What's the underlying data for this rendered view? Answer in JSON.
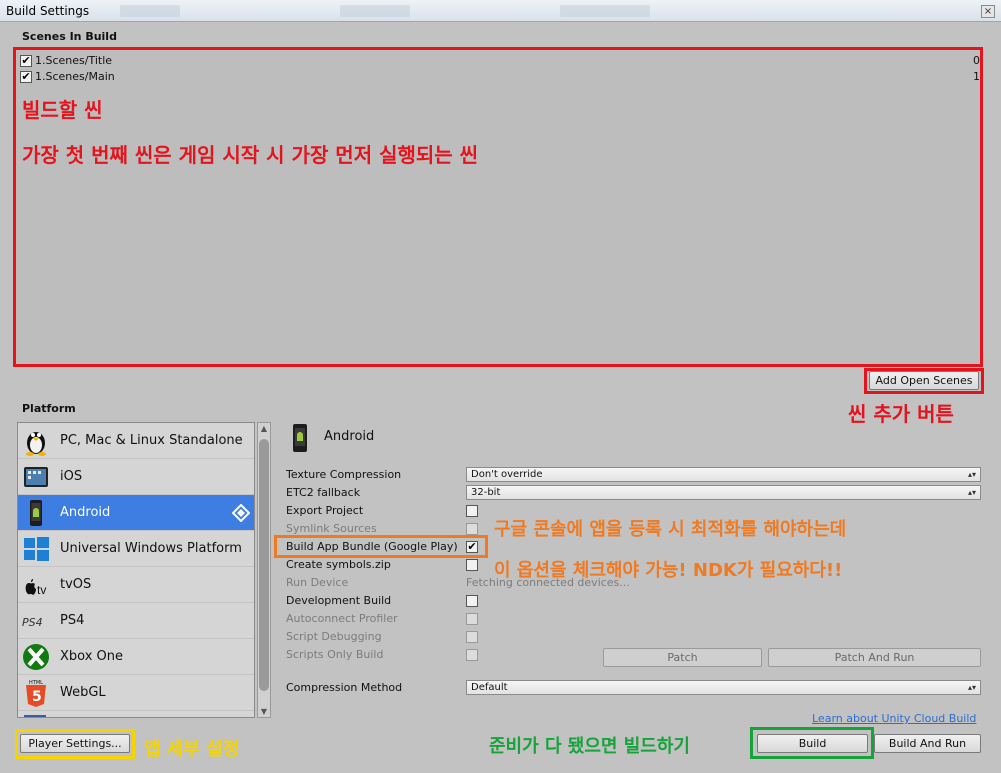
{
  "window": {
    "title": "Build Settings",
    "close_glyph": "×"
  },
  "scenes": {
    "header": "Scenes In Build",
    "items": [
      {
        "name": "1.Scenes/Title",
        "index": "0",
        "checked": "✔"
      },
      {
        "name": "1.Scenes/Main",
        "index": "1",
        "checked": "✔"
      }
    ],
    "add_open_scenes_label": "Add Open Scenes"
  },
  "annotations": {
    "scenes_title": "빌드할 씬",
    "scenes_desc": "가장 첫 번째 씬은 게임 시작 시 가장 먼저 실행되는 씬",
    "add_scene_button": "씬 추가 버튼",
    "bundle_line1": "구글 콘솔에 앱을 등록 시 최적화를 해야하는데",
    "bundle_line2": "이 옵션을 체크해야 가능! NDK가 필요하다!!",
    "player_settings": "앱 세부 설정",
    "build_ready": "준비가 다 됐으면 빌드하기"
  },
  "platform": {
    "header": "Platform",
    "items": [
      {
        "label": "PC, Mac & Linux Standalone",
        "icon": "tux-icon",
        "selected": false
      },
      {
        "label": "iOS",
        "icon": "ipad-icon",
        "selected": false
      },
      {
        "label": "Android",
        "icon": "android-phone-icon",
        "selected": true
      },
      {
        "label": "Universal Windows Platform",
        "icon": "windows-icon",
        "selected": false
      },
      {
        "label": "tvOS",
        "icon": "appletv-icon",
        "selected": false
      },
      {
        "label": "PS4",
        "icon": "ps4-icon",
        "selected": false
      },
      {
        "label": "Xbox One",
        "icon": "xbox-icon",
        "selected": false
      },
      {
        "label": "WebGL",
        "icon": "html5-icon",
        "selected": false
      }
    ],
    "selected_name": "Android",
    "ps4_logo_text": "PS4",
    "html5_logo_text": "HTML",
    "html5_number": "5",
    "tv_logo_text": "tv"
  },
  "settings": {
    "texture_compression": {
      "label": "Texture Compression",
      "value": "Don't override"
    },
    "etc2_fallback": {
      "label": "ETC2 fallback",
      "value": "32-bit"
    },
    "export_project": {
      "label": "Export Project"
    },
    "symlink_sources": {
      "label": "Symlink Sources"
    },
    "build_app_bundle": {
      "label": "Build App Bundle (Google Play)",
      "checked": "✔"
    },
    "create_symbols": {
      "label": "Create symbols.zip"
    },
    "run_device": {
      "label": "Run Device",
      "value": "Fetching connected devices..."
    },
    "development_build": {
      "label": "Development Build"
    },
    "autoconnect_profiler": {
      "label": "Autoconnect Profiler"
    },
    "script_debugging": {
      "label": "Script Debugging"
    },
    "scripts_only_build": {
      "label": "Scripts Only Build"
    },
    "compression_method": {
      "label": "Compression Method",
      "value": "Default"
    }
  },
  "buttons": {
    "patch": "Patch",
    "patch_and_run": "Patch And Run",
    "player_settings": "Player Settings...",
    "build": "Build",
    "build_and_run": "Build And Run",
    "cloud_build_link": "Learn about Unity Cloud Build"
  },
  "colors": {
    "annotation_red": "#e3141e",
    "annotation_orange": "#f07a22",
    "annotation_yellow": "#f5d400",
    "annotation_green": "#16a43a",
    "selection_blue": "#3e7de1"
  }
}
